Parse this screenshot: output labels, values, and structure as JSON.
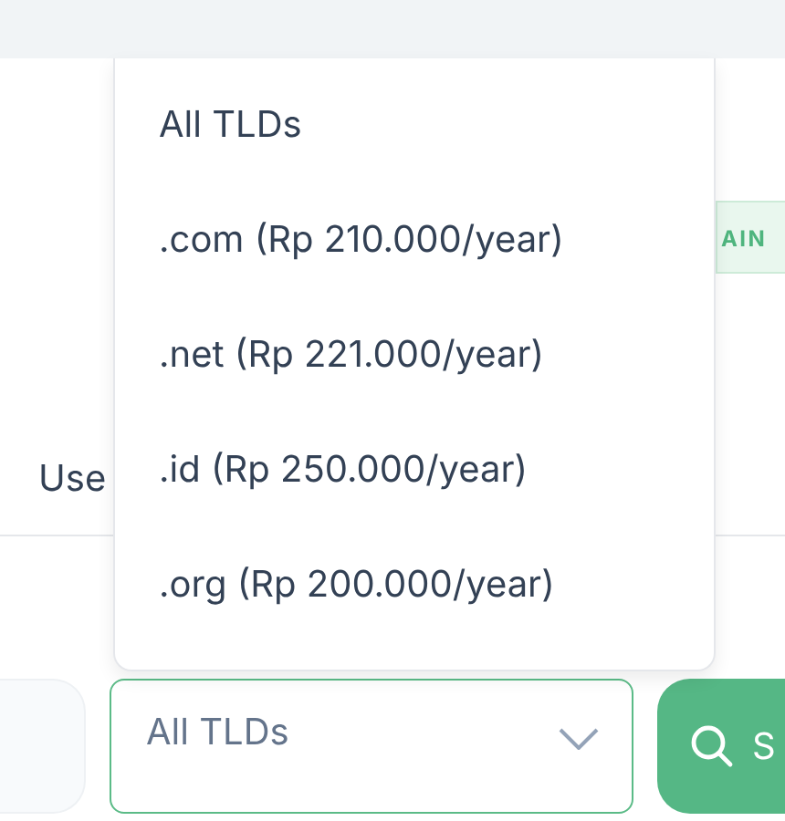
{
  "badge": {
    "label": "AIN"
  },
  "field_label": {
    "text": "Use"
  },
  "search_row": {
    "tld_select": {
      "value": "All TLDs",
      "expanded": true
    },
    "search_button": {
      "label": "S"
    }
  },
  "dropdown": {
    "options": [
      {
        "label": "All TLDs"
      },
      {
        "label": ".com (Rp 210.000/year)"
      },
      {
        "label": ".net (Rp 221.000/year)"
      },
      {
        "label": ".id (Rp 250.000/year)"
      },
      {
        "label": ".org (Rp 200.000/year)"
      }
    ]
  }
}
